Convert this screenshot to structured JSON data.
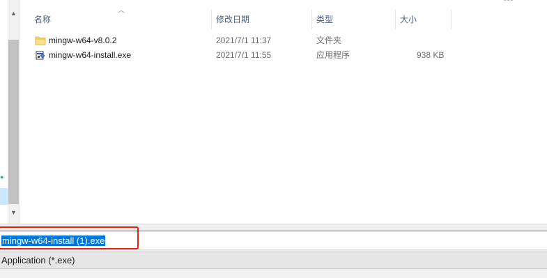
{
  "top_fragment": "件夹",
  "columns": {
    "name": "名称",
    "modified": "修改日期",
    "type": "类型",
    "size": "大小"
  },
  "files": [
    {
      "name": "mingw-w64-v8.0.2",
      "modified": "2021/7/1 11:37",
      "type": "文件夹",
      "size": "",
      "icon": "folder-icon"
    },
    {
      "name": "mingw-w64-install.exe",
      "modified": "2021/7/1 11:55",
      "type": "应用程序",
      "size": "938 KB",
      "icon": "exe-installer-icon"
    }
  ],
  "filename_input": {
    "value": "mingw-w64-install (1).exe"
  },
  "filetype_select": {
    "value": "Application (*.exe)"
  },
  "colors": {
    "selection": "#0078d7",
    "highlight_box": "#e8201a",
    "header_text": "#4c607a"
  }
}
